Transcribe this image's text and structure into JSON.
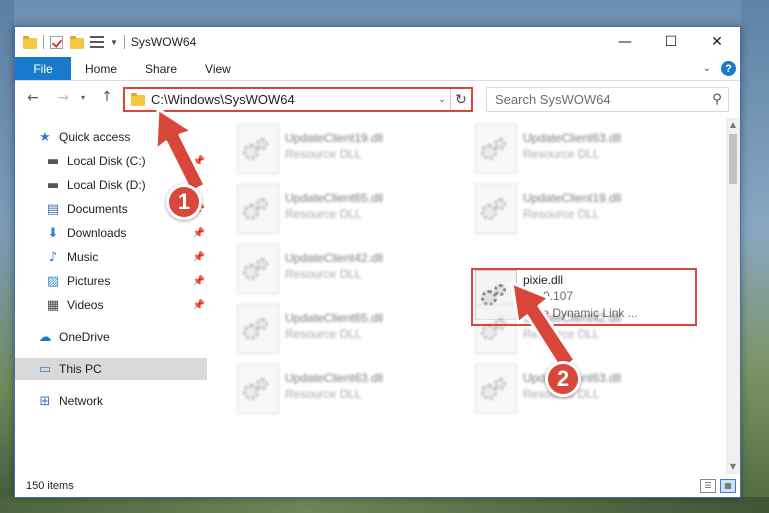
{
  "window": {
    "title": "SysWOW64",
    "minimize": "—",
    "maximize": "☐",
    "close": "✕"
  },
  "ribbon": {
    "tabs": [
      "File",
      "Home",
      "Share",
      "View"
    ],
    "expand_icon": "chevron-down-icon",
    "help_glyph": "?"
  },
  "address_bar": {
    "path": "C:\\Windows\\SysWOW64",
    "refresh_icon": "refresh-icon"
  },
  "search": {
    "placeholder": "Search SysWOW64"
  },
  "sidebar": {
    "quick_access": "Quick access",
    "items": [
      {
        "label": "Local Disk (C:)",
        "icon": "drive-icon",
        "pinned": true
      },
      {
        "label": "Local Disk (D:)",
        "icon": "drive-icon",
        "pinned": true
      },
      {
        "label": "Documents",
        "icon": "documents-icon",
        "pinned": true
      },
      {
        "label": "Downloads",
        "icon": "downloads-icon",
        "pinned": true
      },
      {
        "label": "Music",
        "icon": "music-icon",
        "pinned": true
      },
      {
        "label": "Pictures",
        "icon": "pictures-icon",
        "pinned": true
      },
      {
        "label": "Videos",
        "icon": "videos-icon",
        "pinned": true
      }
    ],
    "onedrive": "OneDrive",
    "this_pc": "This PC",
    "network": "Network"
  },
  "files": {
    "col1": [
      {
        "name": "UpdateClient19.dll",
        "type": "Resource DLL"
      },
      {
        "name": "UpdateClient65.dll",
        "type": "Resource DLL"
      },
      {
        "name": "UpdateClient42.dll",
        "type": "Resource DLL"
      },
      {
        "name": "UpdateClient65.dll",
        "type": "Resource DLL"
      },
      {
        "name": "UpdateClient63.dll",
        "type": "Resource DLL"
      }
    ],
    "col2": [
      {
        "name": "UpdateClient63.dll",
        "type": "Resource DLL"
      },
      {
        "name": "UpdateClient19.dll",
        "type": "Resource DLL"
      },
      {
        "name": "pixie.dll",
        "version": "5.3.0.107",
        "type": "Pixie Dynamic Link ..."
      },
      {
        "name": "UpdateClient42.dll",
        "type": "Resource DLL"
      },
      {
        "name": "UpdateClient63.dll",
        "type": "Resource DLL"
      }
    ]
  },
  "status": {
    "item_count": "150 items"
  },
  "annotations": {
    "step1": "1",
    "step2": "2",
    "color": "#d9463a"
  },
  "colors": {
    "accent": "#1979ca",
    "selection": "#d9d9d9"
  }
}
